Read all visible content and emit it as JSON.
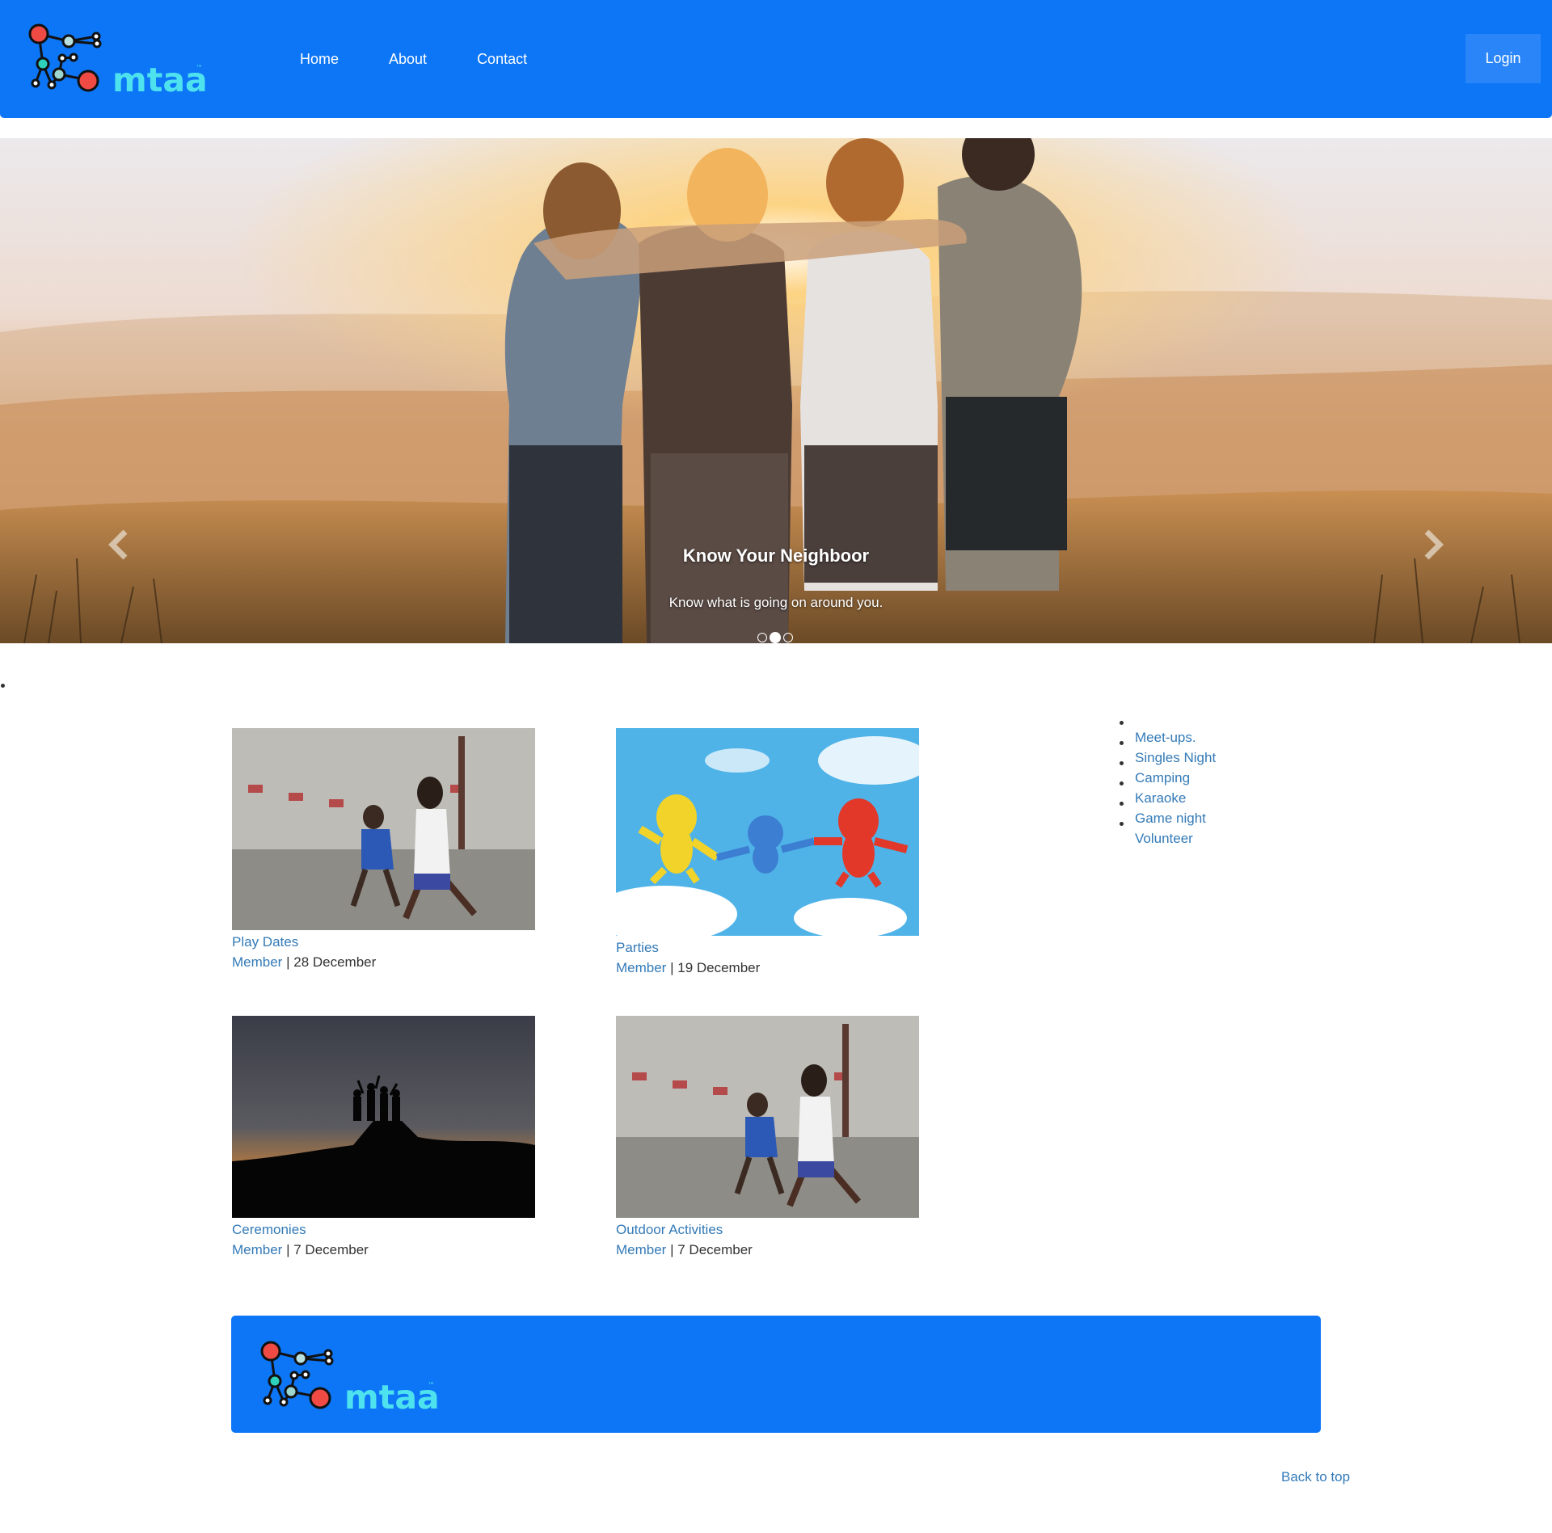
{
  "brand": {
    "name": "mtaa",
    "trademark": "™",
    "primary_color": "#0d76f6",
    "text_color": "#4ee2ee"
  },
  "nav": {
    "links": [
      {
        "label": "Home"
      },
      {
        "label": "About"
      },
      {
        "label": "Contact"
      }
    ],
    "login_label": "Login"
  },
  "hero": {
    "title": "Know Your Neighboor",
    "subtitle": "Know what is going on around you.",
    "prev_icon": "chevron-left-icon",
    "next_icon": "chevron-right-icon",
    "slides": 3,
    "active_slide": 2
  },
  "cards": [
    {
      "title": "Play Dates",
      "author": "Member",
      "separator": " | ",
      "date": "28 December",
      "image": "children-running"
    },
    {
      "title": "Parties",
      "author": "Member",
      "separator": " | ",
      "date": "19 December",
      "image": "toy-monkeys-sky"
    },
    {
      "title": "Ceremonies",
      "author": "Member",
      "separator": " | ",
      "date": "7 December",
      "image": "sunset-silhouettes"
    },
    {
      "title": "Outdoor Activities",
      "author": "Member",
      "separator": " | ",
      "date": "7 December",
      "image": "children-running"
    }
  ],
  "categories": [
    "Meet-ups.",
    "Singles Night",
    "Camping",
    "Karaoke",
    "Game night",
    "Volunteer"
  ],
  "footer": {
    "back_to_top": "Back to top"
  },
  "link_color": "#337ab7"
}
